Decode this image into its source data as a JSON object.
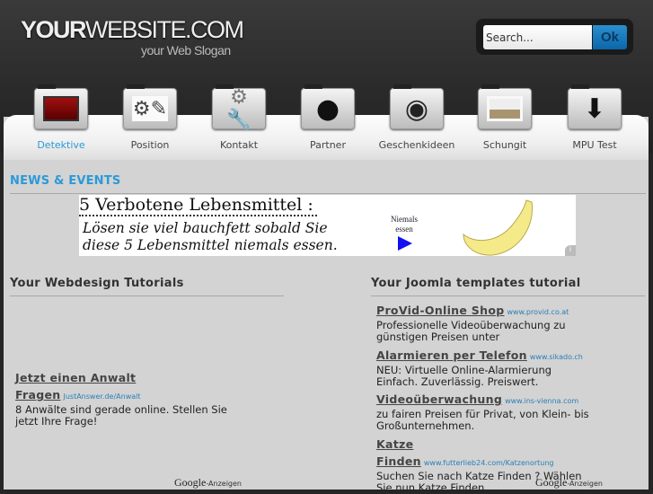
{
  "header": {
    "logo_bold": "YOUR",
    "logo_rest": "WEBSITE.COM",
    "slogan": "your Web Slogan",
    "search_placeholder": "Search...",
    "search_button": "Ok"
  },
  "nav": [
    {
      "label": "Detektive",
      "icon": "folder-red-icon",
      "active": true
    },
    {
      "label": "Position",
      "icon": "gears-pencil-icon"
    },
    {
      "label": "Kontakt",
      "icon": "wrench-gear-icon"
    },
    {
      "label": "Partner",
      "icon": "person-icon"
    },
    {
      "label": "Geschenkideen",
      "icon": "globe-icon"
    },
    {
      "label": "Schungit",
      "icon": "photo-clip-icon"
    },
    {
      "label": "MPU Test",
      "icon": "download-arrow-icon"
    }
  ],
  "news": {
    "title": "NEWS & EVENTS",
    "banner": {
      "title": "5 Verbotene Lebensmittel :",
      "line1": "Lösen sie viel bauchfett sobald Sie",
      "line2": "diese 5 Lebensmittel niemals essen.",
      "cta": "Niemals essen",
      "info": "i"
    }
  },
  "left": {
    "title": "Your Webdesign Tutorials",
    "ads": [
      {
        "title": "Jetzt einen Anwalt Fragen",
        "url": "JustAnswer.de/Anwalt",
        "desc": "8 Anwälte sind gerade online. Stellen Sie jetzt Ihre Frage!"
      }
    ],
    "google_brand": "Google",
    "google_suffix": "-Anzeigen"
  },
  "right": {
    "title": "Your Joomla templates tutorial",
    "ads": [
      {
        "title": "ProVid-Online Shop",
        "url": "www.provid.co.at",
        "desc": "Professionelle Videoüberwachung zu günstigen Preisen unter"
      },
      {
        "title": "Alarmieren per Telefon",
        "url": "www.sikado.ch",
        "desc": "NEU: Virtuelle Online-Alarmierung Einfach. Zuverlässig. Preiswert."
      },
      {
        "title": "Videoüberwachung",
        "url": "www.ins-vienna.com",
        "desc": "zu fairen Preisen für Privat, von Klein- bis Großunternehmen."
      },
      {
        "title": "Katze Finden",
        "url": "www.futterlieb24.com/Katzenortung",
        "desc": "Suchen Sie nach Katze Finden ? Wählen Sie nun Katze Finden."
      }
    ],
    "google_brand": "Google",
    "google_suffix": "-Anzeigen"
  },
  "colors": {
    "accent": "#2a9ad8",
    "panel": "#d3d3d3",
    "header": "#2a2a2a"
  }
}
